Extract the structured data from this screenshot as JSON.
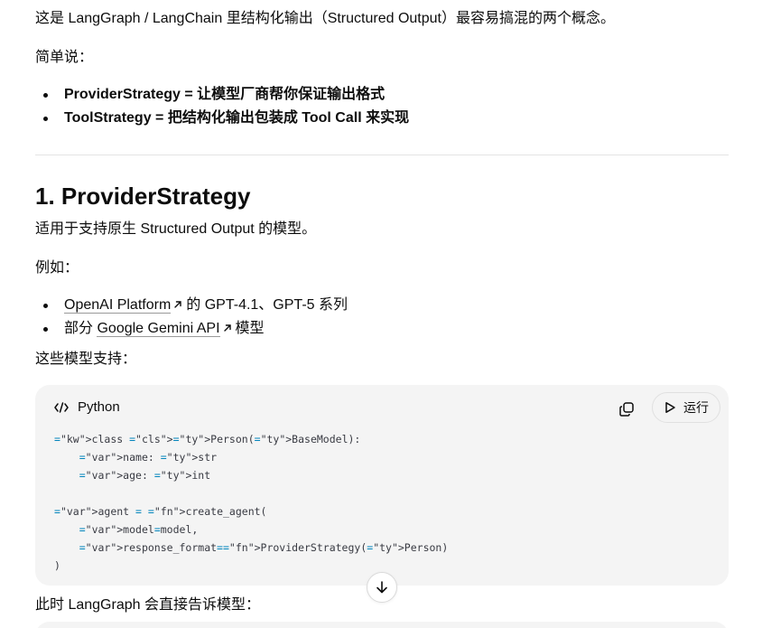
{
  "intro": {
    "paragraph": "这是 LangGraph / LangChain 里结构化输出（Structured Output）最容易搞混的两个概念。",
    "simple_label": "简单说：",
    "summary": [
      "ProviderStrategy = 让模型厂商帮你保证输出格式",
      "ToolStrategy = 把结构化输出包装成 Tool Call 来实现"
    ]
  },
  "section1": {
    "title": "1. ProviderStrategy",
    "applies": "适用于支持原生 Structured Output 的模型。",
    "example_label": "例如：",
    "models": [
      {
        "link": "OpenAI Platform",
        "suffix": "的 GPT-4.1、GPT-5 系列",
        "prefix": ""
      },
      {
        "prefix": "部分",
        "link": "Google Gemini API",
        "suffix": "模型"
      }
    ],
    "supports_label": "这些模型支持："
  },
  "code_block": {
    "language": "Python",
    "run_label": "运行",
    "icons": {
      "language": "code-brackets-icon",
      "copy": "copy-icon",
      "run": "play-icon"
    },
    "lines": [
      "class Person(BaseModel):",
      "    name: str",
      "    age: int",
      "",
      "agent = create_agent(",
      "    model=model,",
      "    response_format=ProviderStrategy(Person)",
      ")"
    ]
  },
  "after_code": "此时 LangGraph 会直接告诉模型：",
  "scroll_icon": "arrow-down-icon",
  "colors": {
    "text": "#0d0d0d",
    "code_bg": "#f4f4f4",
    "divider": "#e3e3e3",
    "keyword": "#a626a4",
    "class_name": "#c18401",
    "function": "#4078f2"
  }
}
